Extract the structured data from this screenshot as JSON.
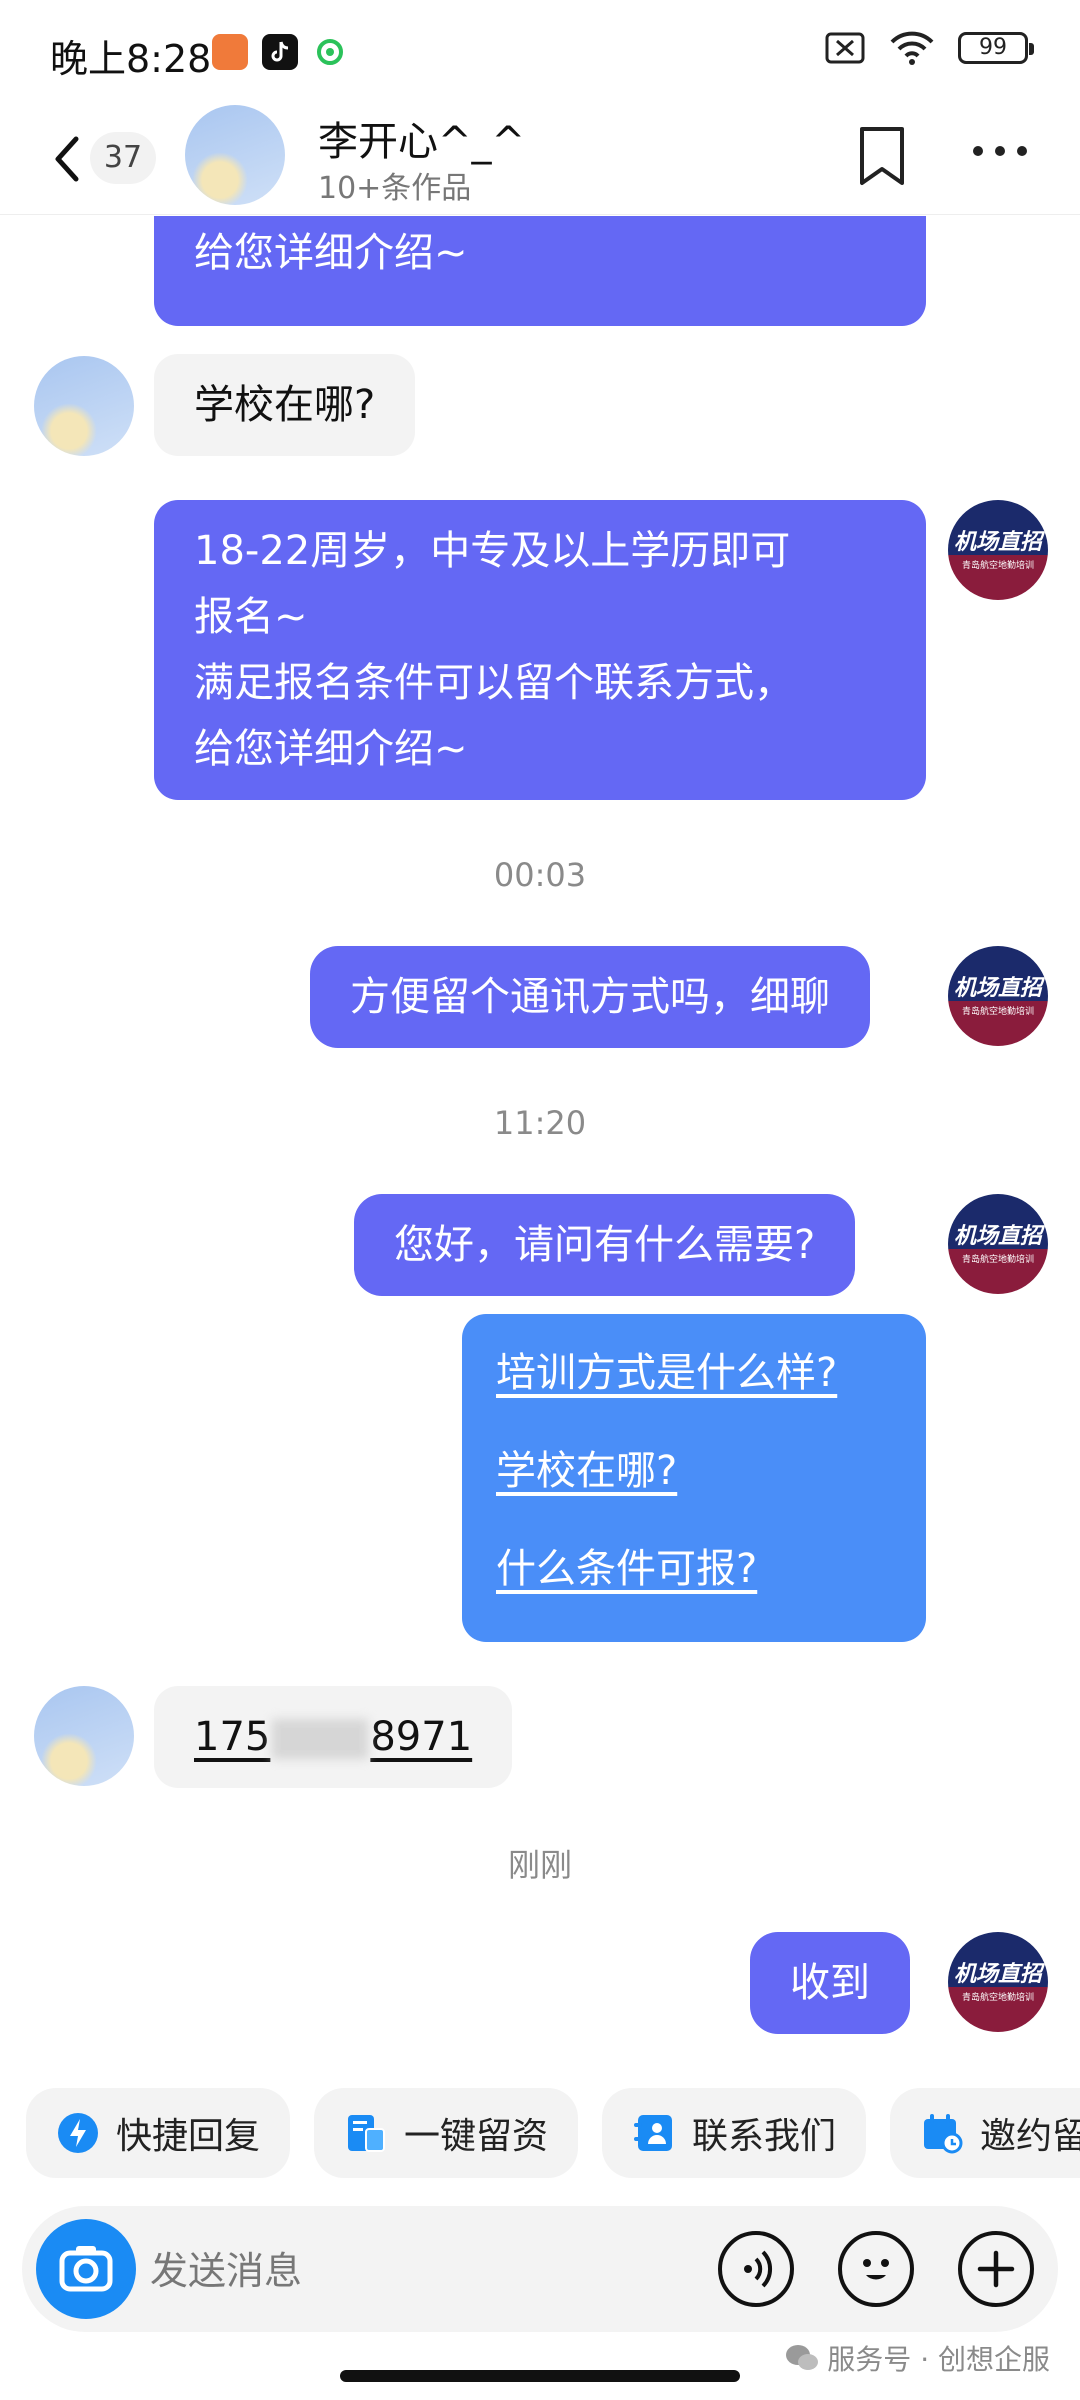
{
  "status_bar": {
    "time": "晚上8:28",
    "battery": "99"
  },
  "header": {
    "back_count": "37",
    "name": "李开心^_^",
    "subtitle": "10+条作品"
  },
  "avatar_me": {
    "line1": "机场直招",
    "line2": "青岛航空地勤培训"
  },
  "messages": {
    "m0": "给您详细介绍~",
    "m1": "学校在哪?",
    "m2_l1": "18-22周岁，中专及以上学历即可",
    "m2_l2": "报名~",
    "m2_l3": "满足报名条件可以留个联系方式，",
    "m2_l4": "给您详细介绍~",
    "ts1": "00:03",
    "m3": "方便留个通讯方式吗，细聊",
    "ts2": "11:20",
    "m4": "您好，请问有什么需要?",
    "links": [
      "培训方式是什么样?",
      "学校在哪?",
      "什么条件可报?"
    ],
    "phone_prefix": "175",
    "phone_suffix": "8971",
    "ts3": "刚刚",
    "m5": "收到"
  },
  "quick_actions": [
    {
      "label": "快捷回复",
      "icon": "lightning-icon"
    },
    {
      "label": "一键留资",
      "icon": "form-icon"
    },
    {
      "label": "联系我们",
      "icon": "contact-icon"
    },
    {
      "label": "邀约留",
      "icon": "calendar-icon"
    }
  ],
  "input": {
    "placeholder": "发送消息"
  },
  "watermark": "服务号 · 创想企服",
  "colors": {
    "my_bubble": "#6468f4",
    "link_card": "#4a8ef8",
    "camera": "#1a8bf4"
  }
}
